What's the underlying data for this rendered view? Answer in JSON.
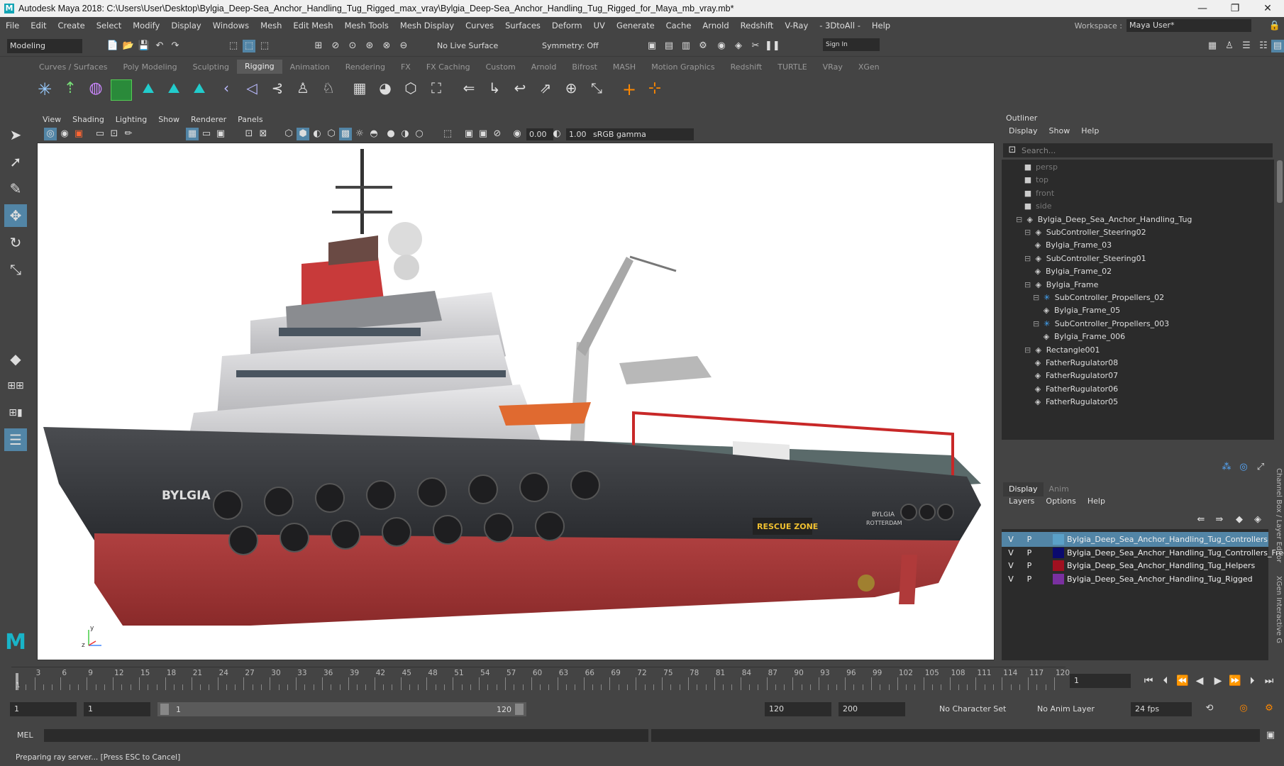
{
  "window": {
    "app_icon": "M",
    "title": "Autodesk Maya 2018: C:\\Users\\User\\Desktop\\Bylgia_Deep-Sea_Anchor_Handling_Tug_Rigged_max_vray\\Bylgia_Deep-Sea_Anchor_Handling_Tug_Rigged_for_Maya_mb_vray.mb*",
    "controls": [
      "minimize-icon",
      "restore-icon",
      "close-icon"
    ]
  },
  "menubar": {
    "items": [
      "File",
      "Edit",
      "Create",
      "Select",
      "Modify",
      "Display",
      "Windows",
      "Mesh",
      "Edit Mesh",
      "Mesh Tools",
      "Mesh Display",
      "Curves",
      "Surfaces",
      "Deform",
      "UV",
      "Generate",
      "Cache",
      "Arnold",
      "Redshift",
      "V-Ray",
      "- 3DtoAll -",
      "Help"
    ],
    "workspace_label": "Workspace :",
    "workspace_value": "Maya User*"
  },
  "status": {
    "mode": "Modeling",
    "live_surface": "No Live Surface",
    "symmetry": "Symmetry: Off",
    "sign_in": "Sign In"
  },
  "shelf": {
    "tabs": [
      "Curves / Surfaces",
      "Poly Modeling",
      "Sculpting",
      "Rigging",
      "Animation",
      "Rendering",
      "FX",
      "FX Caching",
      "Custom",
      "Arnold",
      "Bifrost",
      "MASH",
      "Motion Graphics",
      "Redshift",
      "TURTLE",
      "VRay",
      "XGen"
    ],
    "active_tab": "Rigging"
  },
  "viewport": {
    "menu": [
      "View",
      "Shading",
      "Lighting",
      "Show",
      "Renderer",
      "Panels"
    ],
    "exposure": "0.00",
    "gamma": "1.00",
    "color_space": "sRGB gamma",
    "hull_name": "BYLGIA",
    "stern_name": "BYLGIA",
    "stern_port": "ROTTERDAM",
    "rescue_sign": "RESCUE ZONE",
    "axis_y": "y",
    "axis_z": "z"
  },
  "outliner": {
    "title": "Outliner",
    "menu": [
      "Display",
      "Show",
      "Help"
    ],
    "search_placeholder": "Search...",
    "items": [
      {
        "label": "persp",
        "indent": 0,
        "icon": "camera-icon",
        "dim": true
      },
      {
        "label": "top",
        "indent": 0,
        "icon": "camera-icon",
        "dim": true
      },
      {
        "label": "front",
        "indent": 0,
        "icon": "camera-icon",
        "dim": true
      },
      {
        "label": "side",
        "indent": 0,
        "icon": "camera-icon",
        "dim": true
      },
      {
        "label": "Bylgia_Deep_Sea_Anchor_Handling_Tug",
        "indent": 0,
        "icon": "transform-icon",
        "expand": true
      },
      {
        "label": "SubController_Steering02",
        "indent": 1,
        "icon": "transform-icon",
        "expand": true
      },
      {
        "label": "Bylgia_Frame_03",
        "indent": 2,
        "icon": "transform-icon"
      },
      {
        "label": "SubController_Steering01",
        "indent": 1,
        "icon": "transform-icon",
        "expand": true
      },
      {
        "label": "Bylgia_Frame_02",
        "indent": 2,
        "icon": "transform-icon"
      },
      {
        "label": "Bylgia_Frame",
        "indent": 1,
        "icon": "transform-icon",
        "expand": true
      },
      {
        "label": "SubController_Propellers_02",
        "indent": 2,
        "icon": "joint-icon",
        "expand": true
      },
      {
        "label": "Bylgia_Frame_05",
        "indent": 3,
        "icon": "transform-icon"
      },
      {
        "label": "SubController_Propellers_003",
        "indent": 2,
        "icon": "joint-icon",
        "expand": true
      },
      {
        "label": "Bylgia_Frame_006",
        "indent": 3,
        "icon": "transform-icon"
      },
      {
        "label": "Rectangle001",
        "indent": 1,
        "icon": "transform-icon",
        "expand": true
      },
      {
        "label": "FatherRugulator08",
        "indent": 2,
        "icon": "transform-icon"
      },
      {
        "label": "FatherRugulator07",
        "indent": 2,
        "icon": "transform-icon"
      },
      {
        "label": "FatherRugulator06",
        "indent": 2,
        "icon": "transform-icon"
      },
      {
        "label": "FatherRugulator05",
        "indent": 2,
        "icon": "transform-icon"
      }
    ]
  },
  "channel_box": {
    "tabs": [
      "Display",
      "Anim"
    ],
    "active_tab": "Display",
    "menu": [
      "Layers",
      "Options",
      "Help"
    ],
    "side_label": "Channel Box / Layer Editor",
    "side_label2": "XGen Interactive G",
    "layers": [
      {
        "v": "V",
        "p": "P",
        "color": "#5aa0c8",
        "name": "Bylgia_Deep_Sea_Anchor_Handling_Tug_Controllers",
        "selected": true
      },
      {
        "v": "V",
        "p": "P",
        "color": "#0a0a6e",
        "name": "Bylgia_Deep_Sea_Anchor_Handling_Tug_Controllers_Freeze"
      },
      {
        "v": "V",
        "p": "P",
        "color": "#a01020",
        "name": "Bylgia_Deep_Sea_Anchor_Handling_Tug_Helpers"
      },
      {
        "v": "V",
        "p": "P",
        "color": "#7a30a0",
        "name": "Bylgia_Deep_Sea_Anchor_Handling_Tug_Rigged"
      }
    ]
  },
  "timeline": {
    "ticks": [
      "1",
      "3",
      "6",
      "9",
      "12",
      "15",
      "18",
      "21",
      "24",
      "27",
      "30",
      "33",
      "36",
      "39",
      "42",
      "45",
      "48",
      "51",
      "54",
      "57",
      "60",
      "63",
      "66",
      "69",
      "72",
      "75",
      "78",
      "81",
      "84",
      "87",
      "90",
      "93",
      "96",
      "99",
      "102",
      "105",
      "108",
      "111",
      "114",
      "117",
      "120"
    ],
    "current_frame": "1",
    "current_field": "1"
  },
  "range": {
    "start": "1",
    "playback_start": "1",
    "slider_start": "1",
    "slider_end": "120",
    "playback_end": "120",
    "end": "200",
    "character_set": "No Character Set",
    "anim_layer": "No Anim Layer",
    "fps": "24 fps"
  },
  "cmdline": {
    "label": "MEL"
  },
  "help": {
    "text": "Preparing ray server... [Press ESC to Cancel]"
  }
}
